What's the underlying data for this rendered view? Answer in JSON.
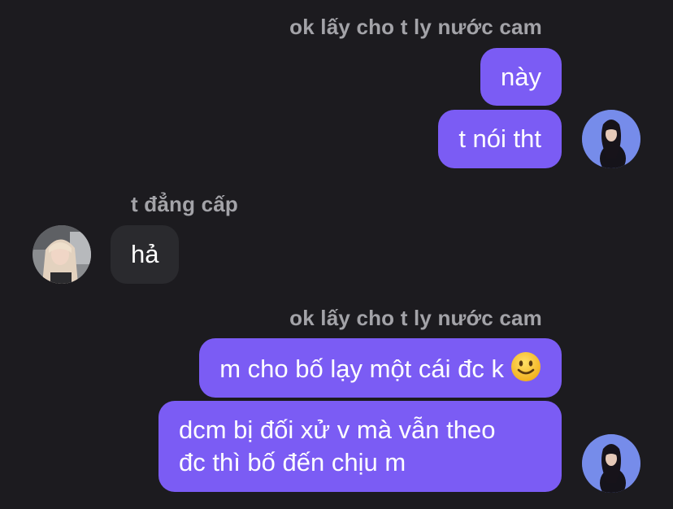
{
  "conversation": {
    "group1": {
      "sender_label": "ok lấy cho t ly nước cam",
      "messages": [
        "này",
        "t nói tht"
      ]
    },
    "group2": {
      "sender_label": "t đẳng cấp",
      "messages": [
        "hả"
      ]
    },
    "group3": {
      "sender_label": "ok lấy cho t ly nước cam",
      "messages": [
        "m cho bố lạy một cái đc k",
        "dcm bị đối xử v mà vẫn theo",
        "đc thì bố đến chịu m"
      ],
      "emoji": "slightly-smiling-face-emoji"
    }
  },
  "colors": {
    "background": "#1c1b1f",
    "outgoing_bubble": "#7b5cf4",
    "incoming_bubble": "#2a2a2e",
    "sender_label": "#a3a3a8",
    "avatar_out_bg": "#6f86e8"
  },
  "icons": {
    "avatar_out": "avatar",
    "avatar_in": "avatar"
  }
}
